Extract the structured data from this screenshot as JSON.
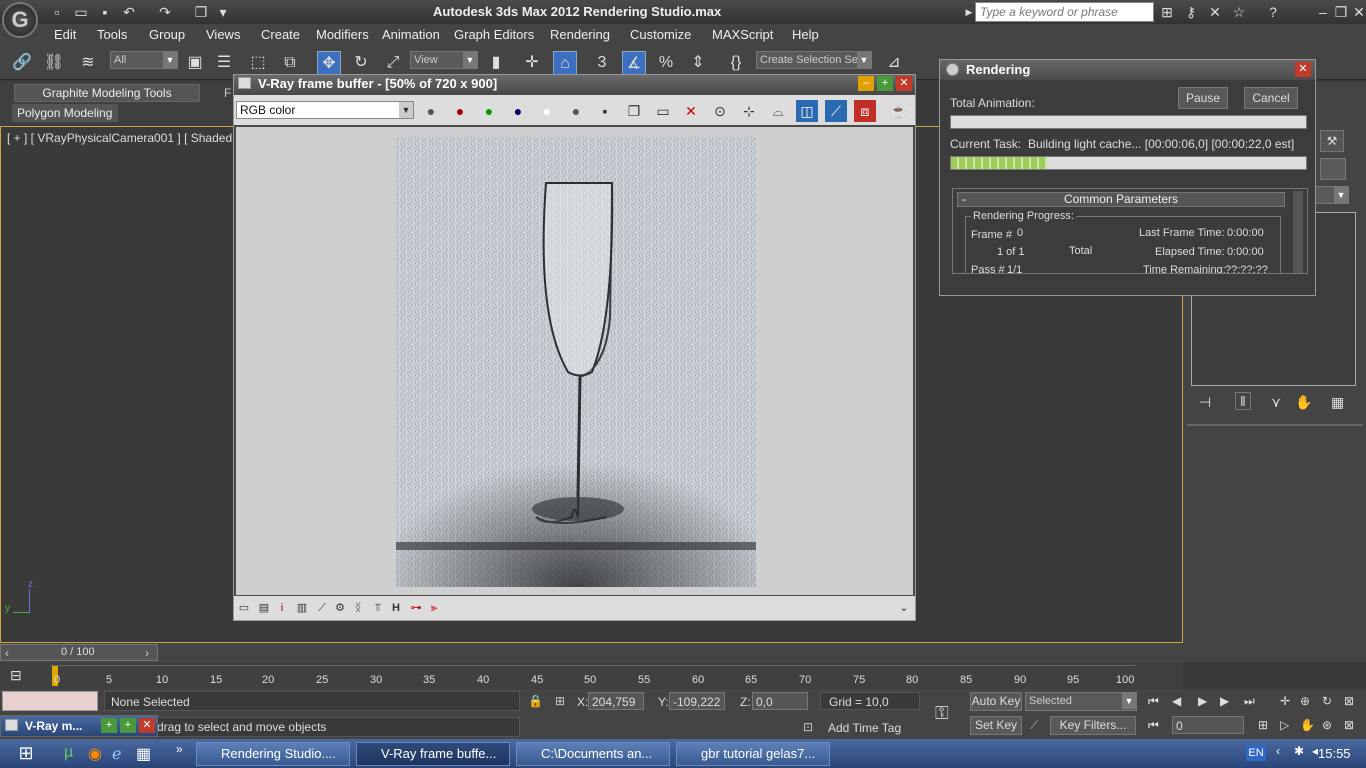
{
  "app": {
    "title": "Autodesk 3ds Max  2012     Rendering Studio.max",
    "logo": "G"
  },
  "search": {
    "placeholder": "Type a keyword or phrase"
  },
  "menu": [
    "Edit",
    "Tools",
    "Group",
    "Views",
    "Create",
    "Modifiers",
    "Animation",
    "Graph Editors",
    "Rendering",
    "Customize",
    "MAXScript",
    "Help"
  ],
  "toolbar": {
    "filter": "All",
    "refcoord": "View",
    "snap": "3",
    "selection_set": "Create Selection Se"
  },
  "ribbon": {
    "tab": "Graphite Modeling Tools",
    "tab2": "F",
    "section": "Polygon Modeling"
  },
  "viewport": {
    "label": "[ + ] [ VRayPhysicalCamera001 ] [ Shaded + E",
    "axis_z": "z",
    "axis_y": "y"
  },
  "vfb": {
    "title": "V-Ray frame buffer - [50% of 720 x 900]",
    "channel": "RGB color",
    "bottom_icons": [
      "i",
      "H"
    ]
  },
  "rendering_dialog": {
    "title": "Rendering",
    "total_animation": "Total Animation:",
    "pause": "Pause",
    "cancel": "Cancel",
    "current_task_label": "Current Task:",
    "current_task": "Building light cache... [00:00:06,0] [00:00:22,0 est]",
    "task_progress": 0.27,
    "rollout": "Common Parameters",
    "rollout_sign": "-",
    "progress_group": "Rendering Progress:",
    "frame_label": "Frame #",
    "frame_value": "0",
    "of_label": "1 of 1",
    "total_label": "Total",
    "pass_label": "Pass #",
    "pass_value": "1/1",
    "last_frame_label": "Last Frame Time:",
    "last_frame_value": "0:00:00",
    "elapsed_label": "Elapsed Time:",
    "elapsed_value": "0:00:00",
    "remaining_label": "Time Remaining:",
    "remaining_value": "??:??:??"
  },
  "timeline": {
    "frame": "0 / 100",
    "ticks": [
      "0",
      "5",
      "10",
      "15",
      "20",
      "25",
      "30",
      "35",
      "40",
      "45",
      "50",
      "55",
      "60",
      "65",
      "70",
      "75",
      "80",
      "85",
      "90",
      "95",
      "100"
    ]
  },
  "status": {
    "selection": "None Selected",
    "hint": "drag to select and move objects",
    "x_label": "X:",
    "x": "204,759",
    "y_label": "Y:",
    "y": "-109,222",
    "z_label": "Z:",
    "z": "0,0",
    "grid": "Grid = 10,0",
    "autokey": "Auto Key",
    "setkey": "Set Key",
    "selected": "Selected",
    "keyfilters": "Key Filters...",
    "addtimetag": "Add Time Tag",
    "frame_field": "0",
    "mini_listener": "V-Ray m..."
  },
  "taskbar": {
    "tasks": [
      "Rendering Studio....",
      "V-Ray frame buffe...",
      "C:\\Documents an...",
      "gbr tutorial gelas7..."
    ],
    "lang": "EN",
    "clock": "15:55"
  }
}
